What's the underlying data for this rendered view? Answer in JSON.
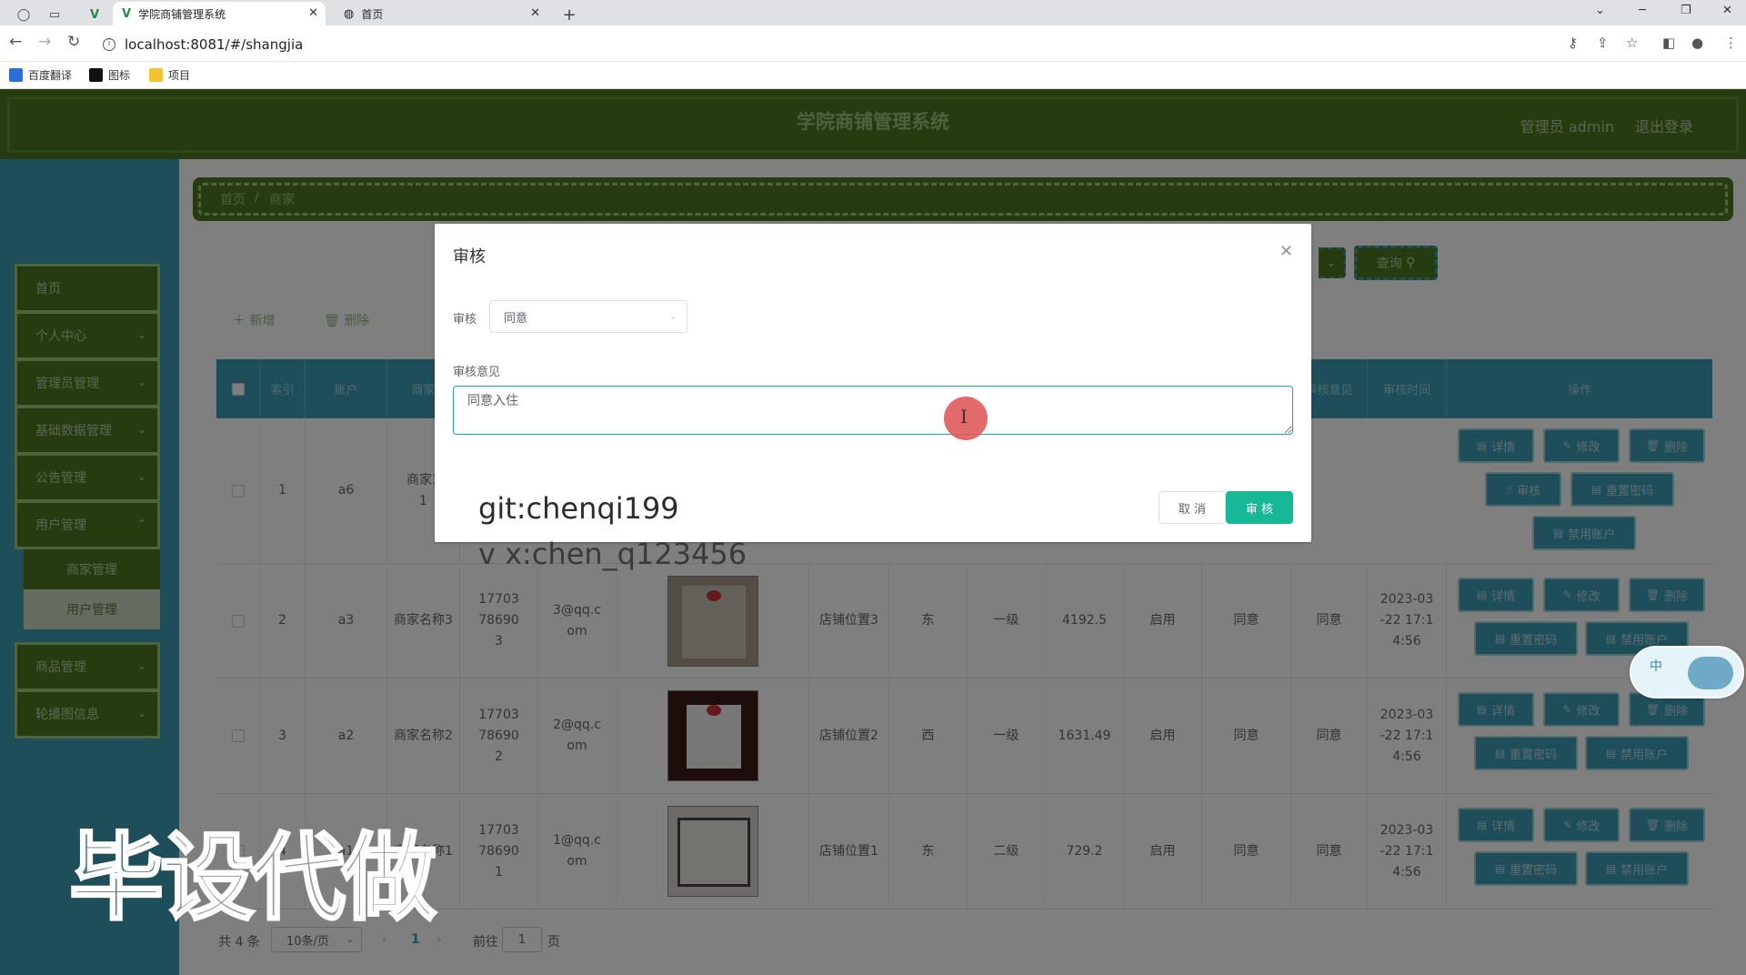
{
  "browser": {
    "tabs": [
      {
        "title": "学院商铺管理系统",
        "active": true
      },
      {
        "title": "首页",
        "active": false
      }
    ],
    "new_tab": "+",
    "url": "localhost:8081/#/shangjia",
    "bookmarks": [
      "百度翻译",
      "图标",
      "项目"
    ]
  },
  "header": {
    "title": "学院商铺管理系统",
    "user": "管理员 admin",
    "logout": "退出登录"
  },
  "sidebar": {
    "items": [
      {
        "label": "首页",
        "has_chevron": false
      },
      {
        "label": "个人中心",
        "has_chevron": true
      },
      {
        "label": "管理员管理",
        "has_chevron": true
      },
      {
        "label": "基础数据管理",
        "has_chevron": true
      },
      {
        "label": "公告管理",
        "has_chevron": true
      },
      {
        "label": "用户管理",
        "has_chevron": true
      },
      {
        "label": "商品管理",
        "has_chevron": true
      },
      {
        "label": "轮播图信息",
        "has_chevron": true
      }
    ],
    "submenu": [
      "商家管理",
      "用户管理"
    ]
  },
  "breadcrumb": {
    "home": "首页",
    "sep": "/",
    "current": "商家"
  },
  "toolbar": {
    "search": "查询",
    "add": "新增",
    "delete": "删除"
  },
  "table": {
    "headers": [
      "索引",
      "账户",
      "商家",
      "审核意见",
      "审核时间",
      "操作"
    ],
    "rows": [
      {
        "index": "1",
        "account": "a6",
        "name": "商家1\n1",
        "phone": "",
        "email": "",
        "location": "",
        "direction": "",
        "level": "",
        "balance": "",
        "status": "",
        "review": "",
        "opinion": "",
        "time": ""
      },
      {
        "index": "2",
        "account": "a3",
        "name": "商家名称3",
        "phone": "17703786903",
        "email": "3@qq.com",
        "location": "店铺位置3",
        "direction": "东",
        "level": "一级",
        "balance": "4192.5",
        "status": "启用",
        "review": "同意",
        "opinion": "同意",
        "time": "2023-03-22 17:14:56"
      },
      {
        "index": "3",
        "account": "a2",
        "name": "商家名称2",
        "phone": "17703786902",
        "email": "2@qq.com",
        "location": "店铺位置2",
        "direction": "西",
        "level": "一级",
        "balance": "1631.49",
        "status": "启用",
        "review": "同意",
        "opinion": "同意",
        "time": "2023-03-22 17:14:56"
      },
      {
        "index": "4",
        "account": "a1",
        "name": "商家名称1",
        "phone": "17703786901",
        "email": "1@qq.com",
        "location": "店铺位置1",
        "direction": "东",
        "level": "二级",
        "balance": "729.2",
        "status": "启用",
        "review": "同意",
        "opinion": "同意",
        "time": "2023-03-22 17:14:56"
      }
    ],
    "ops": {
      "detail": "详情",
      "edit": "修改",
      "delete": "删除",
      "audit": "审核",
      "reset_pwd": "重置密码",
      "disable": "禁用账户"
    }
  },
  "pagination": {
    "total": "共 4 条",
    "page_size": "10条/页",
    "current": "1",
    "goto": "前往",
    "page_input": "1",
    "page_suffix": "页"
  },
  "dialog": {
    "title": "审核",
    "audit_label": "审核",
    "audit_value": "同意",
    "opinion_label": "审核意见",
    "opinion_value": "同意入住",
    "cancel": "取 消",
    "confirm": "审 核"
  },
  "watermarks": {
    "git": "git:chenqi199",
    "wechat": "v x:chen_q123456",
    "big": "毕设代做"
  },
  "ime": {
    "label": "中"
  },
  "colors": {
    "header_green": "#4d7821",
    "sidebar_blue": "#3a9cb5",
    "confirm_teal": "#16b895"
  }
}
